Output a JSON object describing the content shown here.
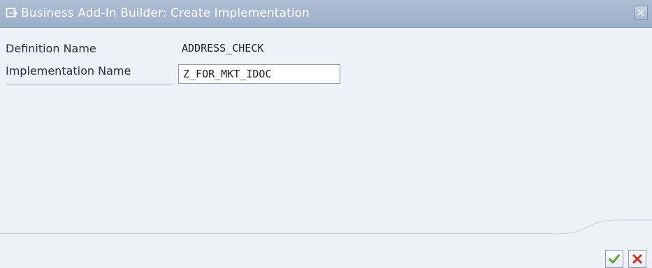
{
  "window": {
    "title": "Business Add-In Builder: Create Implementation",
    "close_label": "×",
    "title_icon": "window-arrow-icon"
  },
  "form": {
    "definition_label": "Definition Name",
    "definition_value": "ADDRESS_CHECK",
    "implementation_label": "Implementation Name",
    "implementation_value": "Z_FOR_MKT_IDOC"
  },
  "buttons": {
    "ok_icon": "check-icon",
    "cancel_icon": "cancel-icon"
  },
  "colors": {
    "titlebar": "#9bb0ca",
    "background": "#eef2f8",
    "ok_green": "#5aa52a",
    "cancel_red": "#d72f1e"
  }
}
